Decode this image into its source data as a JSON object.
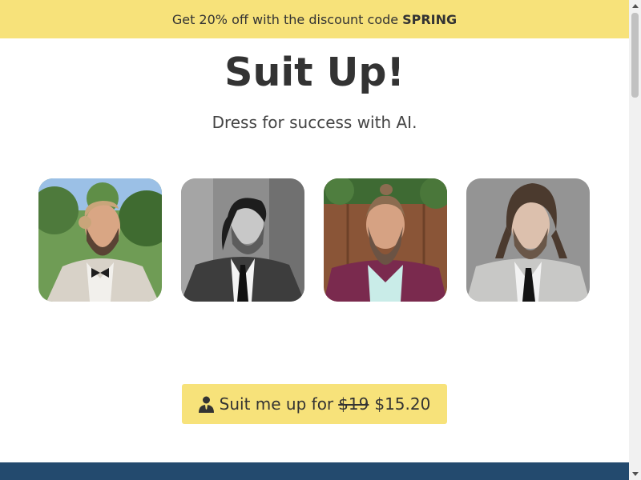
{
  "banner": {
    "text": "Get 20% off with the discount code",
    "code": "SPRING"
  },
  "hero": {
    "title": "Suit Up!",
    "subtitle": "Dress for success with AI."
  },
  "gallery": [
    {
      "name": "portrait-outdoor-bowtie"
    },
    {
      "name": "portrait-grayscale-suit"
    },
    {
      "name": "portrait-maroon-suit"
    },
    {
      "name": "portrait-gray-suit"
    }
  ],
  "cta": {
    "label": "Suit me up for",
    "old_price": "$19",
    "new_price": "$15.20",
    "icon": "person-suit-icon"
  },
  "colors": {
    "accent": "#f7e27a",
    "footer": "#234a6e",
    "text": "#333333"
  }
}
